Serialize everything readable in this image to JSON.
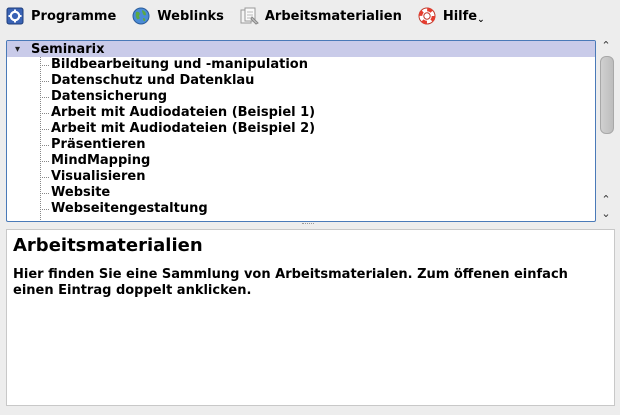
{
  "toolbar": {
    "items": [
      {
        "label": "Programme",
        "icon": "programs-gear-icon"
      },
      {
        "label": "Weblinks",
        "icon": "globe-icon"
      },
      {
        "label": "Arbeitsmaterialien",
        "icon": "documents-icon"
      },
      {
        "label": "Hilfe",
        "icon": "lifebuoy-icon"
      }
    ]
  },
  "tree": {
    "root_label": "Seminarix",
    "root_expanded": true,
    "items": [
      "Bildbearbeitung und -manipulation",
      "Datenschutz und Datenklau",
      "Datensicherung",
      "Arbeit mit Audiodateien (Beispiel 1)",
      "Arbeit mit Audiodateien (Beispiel 2)",
      "Präsentieren",
      "MindMapping",
      "Visualisieren",
      "Website",
      "Webseitengestaltung"
    ]
  },
  "description": {
    "title": "Arbeitsmaterialien",
    "text": "Hier finden Sie eine Sammlung von Arbeitsmaterialen. Zum öffenen einfach einen Eintrag doppelt anklicken."
  },
  "colors": {
    "selection": "#c9cbe9",
    "frame_border": "#4a7ab8"
  }
}
